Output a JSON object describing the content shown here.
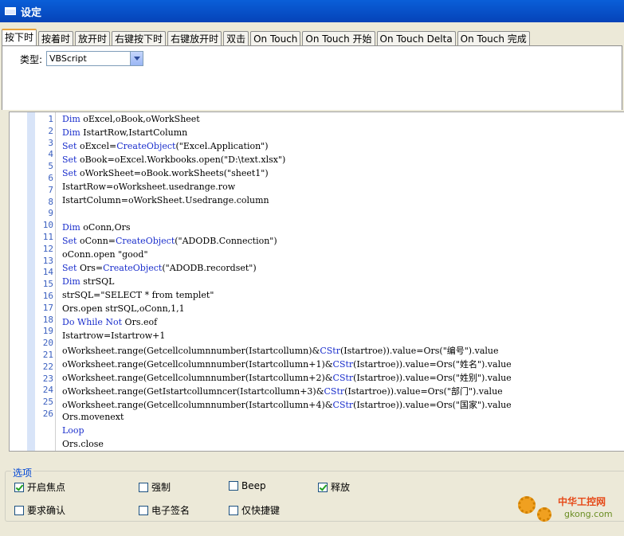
{
  "window": {
    "title": "设定"
  },
  "tabs": [
    {
      "label": "按下时"
    },
    {
      "label": "按着时"
    },
    {
      "label": "放开时"
    },
    {
      "label": "右键按下时"
    },
    {
      "label": "右键放开时"
    },
    {
      "label": "双击"
    },
    {
      "label": "On Touch"
    },
    {
      "label": "On Touch 开始"
    },
    {
      "label": "On Touch Delta"
    },
    {
      "label": "On Touch 完成"
    }
  ],
  "type_field": {
    "label": "类型:",
    "value": "VBScript"
  },
  "code_lines": [
    {
      "n": "1",
      "t": "Dim oExcel,oBook,oWorkSheet"
    },
    {
      "n": "2",
      "t": "Dim IstartRow,IstartColumn"
    },
    {
      "n": "3",
      "t": "Set oExcel=CreateObject(\"Excel.Application\")"
    },
    {
      "n": "4",
      "t": "Set oBook=oExcel.Workbooks.open(\"D:\\text.xlsx\")"
    },
    {
      "n": "5",
      "t": "Set oWorkSheet=oBook.workSheets(\"sheet1\")"
    },
    {
      "n": "6",
      "t": "IstartRow=oWorksheet.usedrange.row"
    },
    {
      "n": "7",
      "t": "IstartColumn=oWorkSheet.Usedrange.column"
    },
    {
      "n": "8",
      "t": ""
    },
    {
      "n": "9",
      "t": "Dim oConn,Ors"
    },
    {
      "n": "10",
      "t": "Set oConn=CreateObject(\"ADODB.Connection\")"
    },
    {
      "n": "11",
      "t": "oConn.open \"good\""
    },
    {
      "n": "12",
      "t": "Set Ors=CreateObject(\"ADODB.recordset\")"
    },
    {
      "n": "13",
      "t": "Dim strSQL"
    },
    {
      "n": "14",
      "t": "strSQL=\"SELECT * from templet\""
    },
    {
      "n": "15",
      "t": "Ors.open strSQL,oConn,1,1"
    },
    {
      "n": "16",
      "t": "Do While Not Ors.eof"
    },
    {
      "n": "17",
      "t": "Istartrow=Istartrow+1"
    },
    {
      "n": "18",
      "t": "oWorksheet.range(Getcellcolumnnumber(Istartcollumn)&CStr(Istartroe)).value=Ors(\"编号\").value"
    },
    {
      "n": "19",
      "t": "oWorksheet.range(Getcellcolumnnumber(Istartcollumn+1)&CStr(Istartroe)).value=Ors(\"姓名\").value"
    },
    {
      "n": "20",
      "t": "oWorksheet.range(Getcellcolumnnumber(Istartcollumn+2)&CStr(Istartroe)).value=Ors(\"姓别\").value"
    },
    {
      "n": "21",
      "t": "oWorksheet.range(GetIstartcollumncer(Istartcollumn+3)&CStr(Istartroe)).value=Ors(\"部门\").value"
    },
    {
      "n": "22",
      "t": "oWorksheet.range(Getcellcolumnnumber(Istartcollumn+4)&CStr(Istartroe)).value=Ors(\"国家\").value"
    },
    {
      "n": "23",
      "t": "Ors.movenext"
    },
    {
      "n": "24",
      "t": "Loop"
    },
    {
      "n": "25",
      "t": "Ors.close"
    },
    {
      "n": "26",
      "t": ""
    }
  ],
  "options": {
    "title": "选项",
    "items": [
      {
        "label": "开启焦点",
        "checked": true
      },
      {
        "label": "强制",
        "checked": false
      },
      {
        "label": "Beep",
        "checked": false
      },
      {
        "label": "释放",
        "checked": true
      },
      {
        "label": "要求确认",
        "checked": false
      },
      {
        "label": "电子签名",
        "checked": false
      },
      {
        "label": "仅快捷键",
        "checked": false
      }
    ]
  },
  "watermark": {
    "name": "中华工控网",
    "site": "gkong.com"
  },
  "colors": {
    "title_bar": "#0a5fd8",
    "keyword": "#1a2ecc",
    "gutter": "#d8e4f8"
  }
}
